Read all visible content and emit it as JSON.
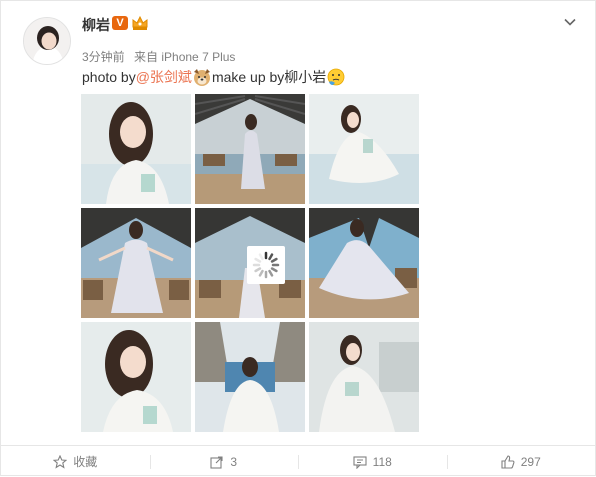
{
  "post": {
    "username": "柳岩",
    "verified_badge": "V",
    "level_badge_icon": "crown-icon",
    "time": "3分钟前",
    "source": "来自 iPhone 7 Plus",
    "text_before": "photo by",
    "mention": "@张剑斌",
    "mention_emoji": "dog-face-icon",
    "text_mid": " make up by柳小岩",
    "end_emoji": "thinking-face-icon",
    "images": [
      {
        "name": "photo-1"
      },
      {
        "name": "photo-2"
      },
      {
        "name": "photo-3"
      },
      {
        "name": "photo-4"
      },
      {
        "name": "photo-5"
      },
      {
        "name": "photo-6"
      },
      {
        "name": "photo-7"
      },
      {
        "name": "photo-8"
      },
      {
        "name": "photo-9"
      }
    ]
  },
  "footer": {
    "favorite_label": "收藏",
    "repost_count": "3",
    "comment_count": "118",
    "like_count": "297"
  },
  "colors": {
    "mention": "#eb7350",
    "verified": "#e8670e",
    "meta": "#808080"
  }
}
